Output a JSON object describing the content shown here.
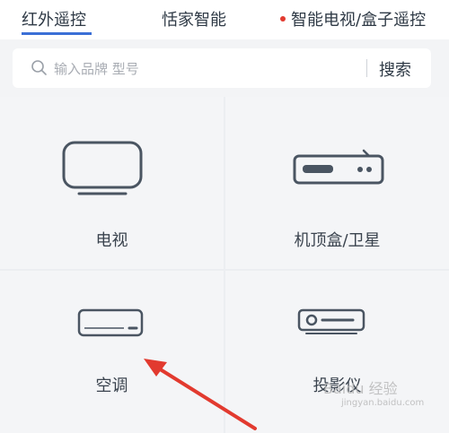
{
  "tabs": [
    {
      "label": "红外遥控",
      "active": true
    },
    {
      "label": "恬家智能",
      "active": false
    },
    {
      "label": "智能电视/盒子遥控",
      "active": false,
      "has_dot": true
    }
  ],
  "search": {
    "placeholder": "输入品牌 型号",
    "button_label": "搜索"
  },
  "devices": [
    {
      "label": "电视",
      "icon": "tv-icon"
    },
    {
      "label": "机顶盒/卫星",
      "icon": "set-top-box-icon"
    },
    {
      "label": "空调",
      "icon": "air-conditioner-icon"
    },
    {
      "label": "投影仪",
      "icon": "projector-icon"
    }
  ],
  "watermark": {
    "text": "Baidu 经验",
    "subtext": "jingyan.baidu.com"
  },
  "colors": {
    "accent": "#3b6fd6",
    "dot": "#e23a2f",
    "icon_stroke": "#4a5562",
    "arrow": "#e23a2f"
  }
}
